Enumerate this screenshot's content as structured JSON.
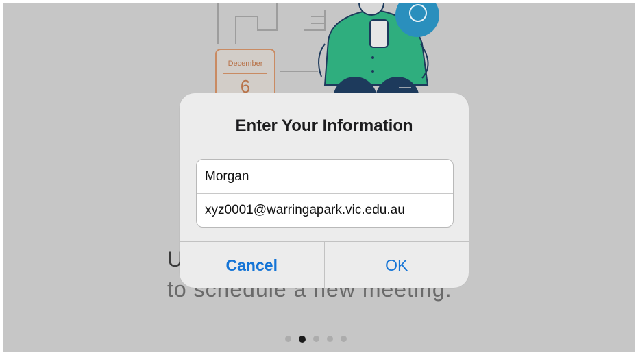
{
  "background": {
    "calendar_month": "December",
    "calendar_day": "6",
    "text_line1": "U                              r",
    "text_line2": "to schedule a new meeting.",
    "pager_total": 5,
    "pager_active_index": 1
  },
  "dialog": {
    "title": "Enter Your Information",
    "name_value": "Morgan",
    "email_value": "xyz0001@warringapark.vic.edu.au",
    "cancel_label": "Cancel",
    "ok_label": "OK"
  },
  "colors": {
    "dim_background": "#c6c6c6",
    "button_blue": "#1474d6",
    "illustration_green": "#2fae7e",
    "illustration_navy": "#1d3a5c",
    "chat_bubble_blue": "#2a8fbd"
  }
}
